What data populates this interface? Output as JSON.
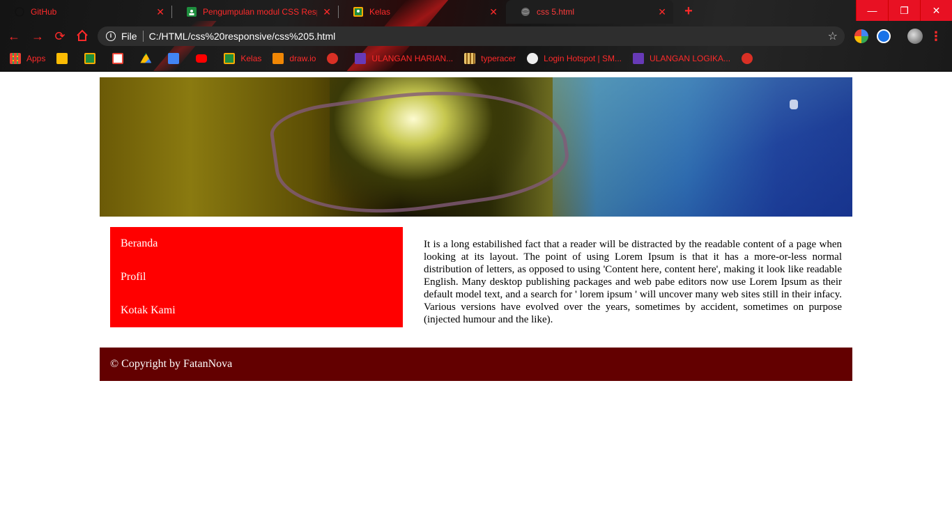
{
  "browser": {
    "tabs": [
      {
        "title": "GitHub",
        "icon": "github-icon"
      },
      {
        "title": "Pengumpulan modul CSS Respon",
        "icon": "google-classroom-icon"
      },
      {
        "title": "Kelas",
        "icon": "google-classroom-icon"
      },
      {
        "title": "css 5.html",
        "icon": "globe-icon"
      }
    ],
    "new_tab": "+",
    "window_controls": {
      "minimize": "—",
      "restore": "❐",
      "close": "✕"
    },
    "address": {
      "scheme": "File",
      "url": "C:/HTML/css%20responsive/css%205.html"
    },
    "bookmarks": [
      {
        "label": "Apps",
        "icon": "apps-grid-icon"
      },
      {
        "label": "",
        "icon": "google-keep-icon"
      },
      {
        "label": "",
        "icon": "google-classroom-icon"
      },
      {
        "label": "",
        "icon": "gmail-icon"
      },
      {
        "label": "",
        "icon": "google-drive-icon"
      },
      {
        "label": "",
        "icon": "google-docs-icon"
      },
      {
        "label": "",
        "icon": "youtube-icon"
      },
      {
        "label": "Kelas",
        "icon": "google-classroom-icon"
      },
      {
        "label": "draw.io",
        "icon": "drawio-icon"
      },
      {
        "label": "",
        "icon": "globe-icon"
      },
      {
        "label": "ULANGAN HARIAN...",
        "icon": "google-forms-icon"
      },
      {
        "label": "typeracer",
        "icon": "typeracer-icon"
      },
      {
        "label": "Login Hotspot | SM...",
        "icon": "hotspot-icon"
      },
      {
        "label": "ULANGAN LOGIKA...",
        "icon": "google-forms-icon"
      },
      {
        "label": "",
        "icon": "globe-icon"
      }
    ],
    "colors": {
      "accent": "#ff2a2a",
      "window_close": "#e81123"
    }
  },
  "page": {
    "nav": [
      "Beranda",
      "Profil",
      "Kotak Kami"
    ],
    "article": "It is a long estabilished fact that a reader will be distracted by the readable content of a page when looking at its layout. The point of using Lorem Ipsum is that it has a more-or-less normal distribution of letters, as opposed to using 'Content here, content here', making it look like readable English. Many desktop publishing packages and web pabe editors now use Lorem Ipsum as their default model text, and a search for ' lorem ipsum ' will uncover many web sites still in their infacy. Various versions have evolved over the years, sometimes by accident, sometimes on purpose (injected humour and the like).",
    "footer": "© Copyright by FatanNova",
    "colors": {
      "nav_bg": "#ff0000",
      "footer_bg": "#630000"
    }
  }
}
